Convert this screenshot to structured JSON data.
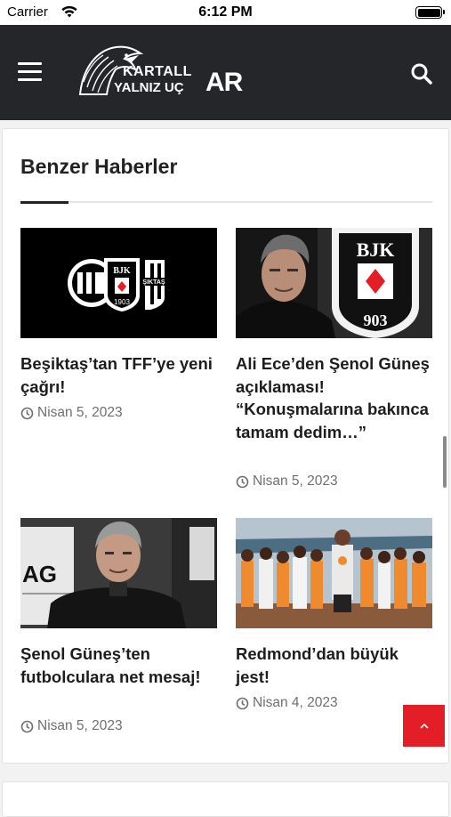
{
  "status_bar": {
    "carrier": "Carrier",
    "time": "6:12 PM"
  },
  "header": {
    "logo_line1": "KARTALL",
    "logo_line2": "YALNIZ UÇ",
    "logo_suffix": "AR"
  },
  "section": {
    "title": "Benzer Haberler"
  },
  "articles": [
    {
      "title": "Beşiktaş’tan TFF’ye yeni çağrı!",
      "date": "Nisan 5, 2023"
    },
    {
      "title": "Ali Ece’den Şenol Güneş açıklaması! “Konuşmalarına bakınca tamam dedim…”",
      "date": "Nisan 5, 2023"
    },
    {
      "title": "Şenol Güneş’ten futbolculara net mesaj!",
      "date": "Nisan 5, 2023"
    },
    {
      "title": "Redmond’dan büyük jest!",
      "date": "Nisan 4, 2023"
    }
  ],
  "colors": {
    "header_bg": "#24262a",
    "accent": "#e41e26"
  }
}
